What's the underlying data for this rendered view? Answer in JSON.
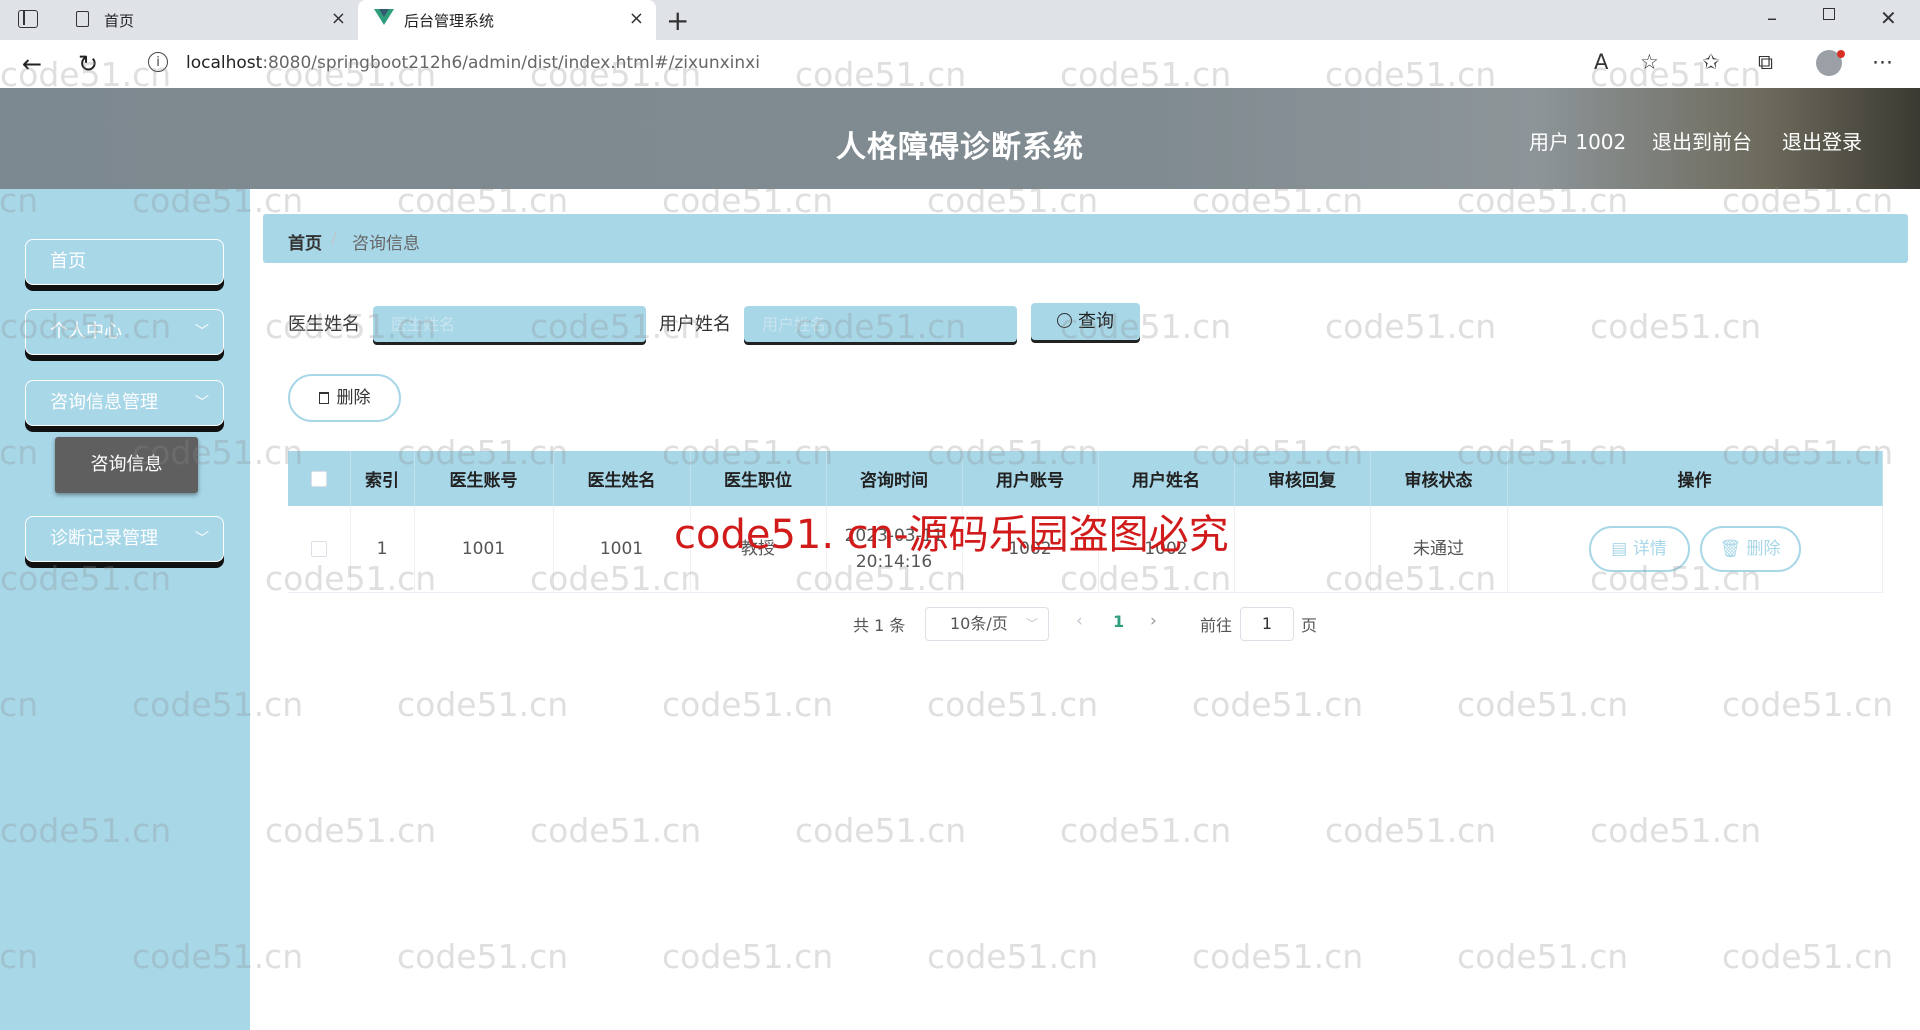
{
  "browser": {
    "tabs": [
      {
        "label": "首页"
      },
      {
        "label": "后台管理系统"
      }
    ],
    "close_glyph": "×",
    "new_tab_glyph": "+",
    "url_host": "localhost",
    "url_rest": ":8080/springboot212h6/admin/dist/index.html#/zixunxinxi",
    "icons": [
      "sidebar-icon",
      "page-icon",
      "vue-logo-icon",
      "back-icon",
      "refresh-icon",
      "info-icon",
      "read-aloud-icon",
      "favorite-add-icon",
      "favorites-icon",
      "collections-icon",
      "profile-icon",
      "more-icon",
      "minimize-icon",
      "restore-icon",
      "close-window-icon"
    ]
  },
  "header": {
    "title": "人格障碍诊断系统",
    "user": "用户 1002",
    "to_front": "退出到前台",
    "logout": "退出登录"
  },
  "sidebar": {
    "items": [
      {
        "label": "首页"
      },
      {
        "label": "个人中心"
      },
      {
        "label": "咨询信息管理"
      },
      {
        "label": "诊断记录管理"
      }
    ],
    "active_sub": "咨询信息",
    "chevron": "﹀"
  },
  "breadcrumb": {
    "home": "首页",
    "sep": "/",
    "current": "咨询信息"
  },
  "filters": {
    "doctor_name_label": "医生姓名",
    "doctor_name_placeholder": "医生姓名",
    "user_name_label": "用户姓名",
    "user_name_placeholder": "用户姓名",
    "query_label": "查询",
    "delete_label": "删除"
  },
  "table": {
    "headers": [
      "",
      "索引",
      "医生账号",
      "医生姓名",
      "医生职位",
      "咨询时间",
      "用户账号",
      "用户姓名",
      "审核回复",
      "审核状态",
      "操作"
    ],
    "rows": [
      {
        "index": "1",
        "doctor_account": "1001",
        "doctor_name": "1001",
        "doctor_title": "教授",
        "time_date": "2023-03-11",
        "time_clock": "20:14:16",
        "user_account": "1002",
        "user_name": "1002",
        "reply": "",
        "status": "未通过",
        "detail_label": "详情",
        "delete_label": "删除"
      }
    ]
  },
  "pagination": {
    "total": "共 1 条",
    "page_size": "10条/页",
    "prev": "‹",
    "current": "1",
    "next": "›",
    "goto": "前往",
    "jump_value": "1",
    "page_unit": "页"
  },
  "watermark": {
    "text": "code51.cn",
    "red_text": "code51. cn-源码乐园盗图必究"
  },
  "colors": {
    "accent": "#a8d7e8",
    "header": "#808b91",
    "active_page": "#2f9e7c"
  }
}
